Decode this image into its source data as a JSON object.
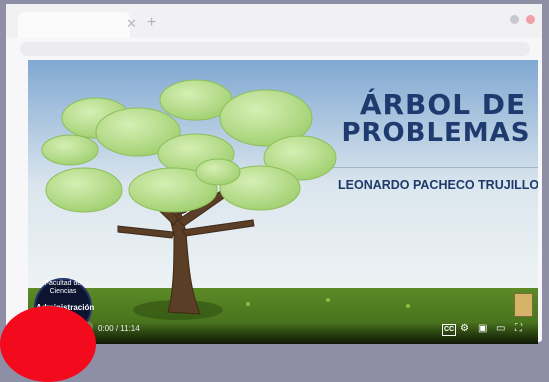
{
  "video": {
    "title_line1": "ÁRBOL DE",
    "title_line2": "PROBLEMAS",
    "author": "LEONARDO PACHECO TRUJILLO",
    "channel_small": "Facultad de Ciencias",
    "channel_big": "Administración",
    "time_current": "0:00",
    "time_total": "11:14"
  },
  "icons": {
    "tab_close": "✕",
    "new_tab": "+",
    "volume": "🔊",
    "subtitles": "CC",
    "settings": "⚙",
    "miniplayer": "▣",
    "theater": "▭",
    "fullscreen": "⛶"
  },
  "colors": {
    "sky_top": "#7fa7cf",
    "title_color": "#1f3a6e",
    "grass": "#4f7d1f",
    "leaf": "#b7dc8f",
    "trunk": "#5a3e26",
    "red_badge": "#f30a1c"
  }
}
